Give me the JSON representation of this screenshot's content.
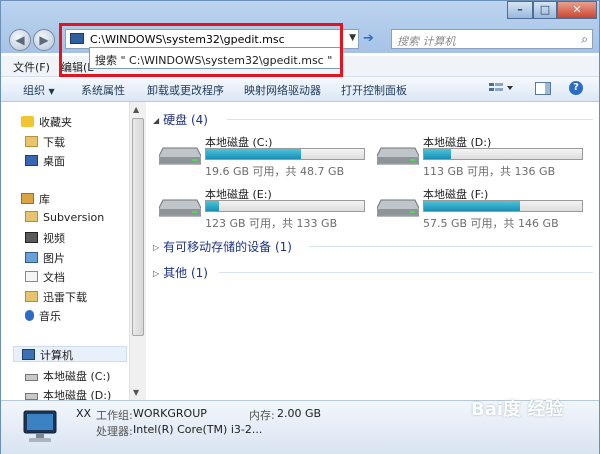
{
  "window": {
    "controls": {
      "minimize": "–",
      "maximize": "□",
      "close": "✕"
    },
    "nav": {
      "back": "◀",
      "forward": "▶"
    },
    "address": {
      "value": "C:\\WINDOWS\\system32\\gpedit.msc"
    },
    "suggestion": "搜索 \" C:\\WINDOWS\\system32\\gpedit.msc \"",
    "search": {
      "placeholder": "搜索 计算机"
    }
  },
  "menu": {
    "file": "文件(F)",
    "edit": "编辑(E"
  },
  "toolbar": {
    "organize": "组织",
    "system_properties": "系统属性",
    "uninstall": "卸载或更改程序",
    "map_drive": "映射网络驱动器",
    "control_panel": "打开控制面板",
    "help": "?"
  },
  "sidebar": {
    "favorites": "收藏夹",
    "downloads": "下载",
    "desktop": "桌面",
    "libraries": "库",
    "subversion": "Subversion",
    "videos": "视频",
    "pictures": "图片",
    "documents": "文档",
    "thunder": "迅雷下载",
    "music": "音乐",
    "computer": "计算机",
    "disk_c": "本地磁盘 (C:)",
    "disk_d": "本地磁盘 (D:)"
  },
  "groups": {
    "hdd": "硬盘 (4)",
    "removable": "有可移动存储的设备 (1)",
    "other": "其他 (1)"
  },
  "drives": [
    {
      "name": "本地磁盘 (C:)",
      "info": "19.6 GB 可用，共 48.7 GB",
      "used_fraction": 0.6
    },
    {
      "name": "本地磁盘 (D:)",
      "info": "113 GB 可用，共 136 GB",
      "used_fraction": 0.17
    },
    {
      "name": "本地磁盘 (E:)",
      "info": "123 GB 可用，共 133 GB",
      "used_fraction": 0.08
    },
    {
      "name": "本地磁盘 (F:)",
      "info": "57.5 GB 可用，共 146 GB",
      "used_fraction": 0.61
    }
  ],
  "details": {
    "name": "XX",
    "workgroup_label": "工作组:",
    "workgroup": "WORKGROUP",
    "memory_label": "内存:",
    "memory": "2.00 GB",
    "cpu_label": "处理器:",
    "cpu": "Intel(R) Core(TM) i3-2..."
  },
  "watermark": "Bai度 经验",
  "colors": {
    "highlight": "#e3141f",
    "drive_fill": "#1b8fb4",
    "group_header": "#1e3287"
  }
}
